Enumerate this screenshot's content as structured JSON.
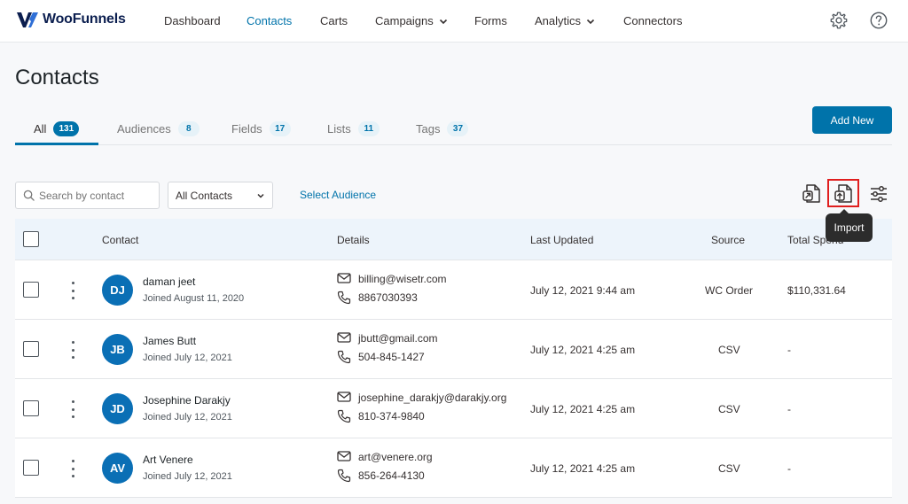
{
  "brand": {
    "name": "WooFunnels"
  },
  "nav": {
    "items": [
      {
        "label": "Dashboard",
        "dropdown": false,
        "active": false
      },
      {
        "label": "Contacts",
        "dropdown": false,
        "active": true
      },
      {
        "label": "Carts",
        "dropdown": false,
        "active": false
      },
      {
        "label": "Campaigns",
        "dropdown": true,
        "active": false
      },
      {
        "label": "Forms",
        "dropdown": false,
        "active": false
      },
      {
        "label": "Analytics",
        "dropdown": true,
        "active": false
      },
      {
        "label": "Connectors",
        "dropdown": false,
        "active": false
      }
    ],
    "icons": [
      "gear-icon",
      "help-icon"
    ]
  },
  "page": {
    "title": "Contacts"
  },
  "tabs": [
    {
      "label": "All",
      "count": "131",
      "active": true
    },
    {
      "label": "Audiences",
      "count": "8",
      "active": false
    },
    {
      "label": "Fields",
      "count": "17",
      "active": false
    },
    {
      "label": "Lists",
      "count": "11",
      "active": false
    },
    {
      "label": "Tags",
      "count": "37",
      "active": false
    }
  ],
  "actions": {
    "add_new_label": "Add New"
  },
  "filters": {
    "search_placeholder": "Search by contact",
    "contact_filter": "All Contacts",
    "select_audience_label": "Select Audience"
  },
  "tools": {
    "export_icon": "export-icon",
    "import_icon": "import-icon",
    "settings_icon": "sliders-icon",
    "tooltip": "Import"
  },
  "table": {
    "headers": {
      "contact": "Contact",
      "details": "Details",
      "last_updated": "Last Updated",
      "source": "Source",
      "total_spend": "Total Spend"
    },
    "rows": [
      {
        "initials": "DJ",
        "name": "daman jeet",
        "joined": "Joined August 11, 2020",
        "email": "billing@wisetr.com",
        "phone": "8867030393",
        "last_updated": "July 12, 2021 9:44 am",
        "source": "WC Order",
        "total_spend": "$110,331.64"
      },
      {
        "initials": "JB",
        "name": "James Butt",
        "joined": "Joined July 12, 2021",
        "email": "jbutt@gmail.com",
        "phone": "504-845-1427",
        "last_updated": "July 12, 2021 4:25 am",
        "source": "CSV",
        "total_spend": "-"
      },
      {
        "initials": "JD",
        "name": "Josephine Darakjy",
        "joined": "Joined July 12, 2021",
        "email": "josephine_darakjy@darakjy.org",
        "phone": "810-374-9840",
        "last_updated": "July 12, 2021 4:25 am",
        "source": "CSV",
        "total_spend": "-"
      },
      {
        "initials": "AV",
        "name": "Art Venere",
        "joined": "Joined July 12, 2021",
        "email": "art@venere.org",
        "phone": "856-264-4130",
        "last_updated": "July 12, 2021 4:25 am",
        "source": "CSV",
        "total_spend": "-"
      }
    ]
  },
  "colors": {
    "accent": "#0073aa",
    "avatar": "#0a6fb5",
    "highlight": "#e01e1e",
    "header_bg": "#edf4fb"
  }
}
